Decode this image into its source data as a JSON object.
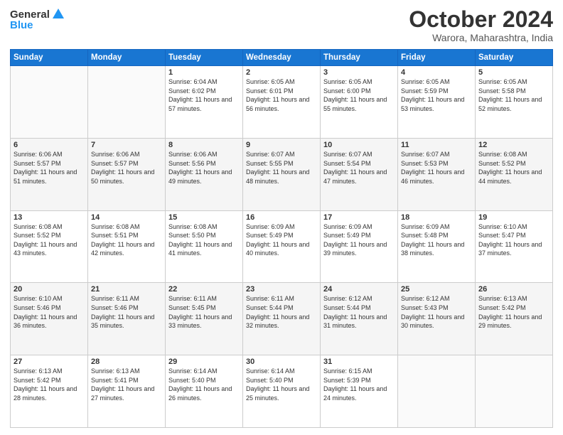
{
  "header": {
    "logo_line1": "General",
    "logo_line2": "Blue",
    "month": "October 2024",
    "location": "Warora, Maharashtra, India"
  },
  "weekdays": [
    "Sunday",
    "Monday",
    "Tuesday",
    "Wednesday",
    "Thursday",
    "Friday",
    "Saturday"
  ],
  "weeks": [
    [
      {
        "day": "",
        "info": ""
      },
      {
        "day": "",
        "info": ""
      },
      {
        "day": "1",
        "info": "Sunrise: 6:04 AM\nSunset: 6:02 PM\nDaylight: 11 hours and 57 minutes."
      },
      {
        "day": "2",
        "info": "Sunrise: 6:05 AM\nSunset: 6:01 PM\nDaylight: 11 hours and 56 minutes."
      },
      {
        "day": "3",
        "info": "Sunrise: 6:05 AM\nSunset: 6:00 PM\nDaylight: 11 hours and 55 minutes."
      },
      {
        "day": "4",
        "info": "Sunrise: 6:05 AM\nSunset: 5:59 PM\nDaylight: 11 hours and 53 minutes."
      },
      {
        "day": "5",
        "info": "Sunrise: 6:05 AM\nSunset: 5:58 PM\nDaylight: 11 hours and 52 minutes."
      }
    ],
    [
      {
        "day": "6",
        "info": "Sunrise: 6:06 AM\nSunset: 5:57 PM\nDaylight: 11 hours and 51 minutes."
      },
      {
        "day": "7",
        "info": "Sunrise: 6:06 AM\nSunset: 5:57 PM\nDaylight: 11 hours and 50 minutes."
      },
      {
        "day": "8",
        "info": "Sunrise: 6:06 AM\nSunset: 5:56 PM\nDaylight: 11 hours and 49 minutes."
      },
      {
        "day": "9",
        "info": "Sunrise: 6:07 AM\nSunset: 5:55 PM\nDaylight: 11 hours and 48 minutes."
      },
      {
        "day": "10",
        "info": "Sunrise: 6:07 AM\nSunset: 5:54 PM\nDaylight: 11 hours and 47 minutes."
      },
      {
        "day": "11",
        "info": "Sunrise: 6:07 AM\nSunset: 5:53 PM\nDaylight: 11 hours and 46 minutes."
      },
      {
        "day": "12",
        "info": "Sunrise: 6:08 AM\nSunset: 5:52 PM\nDaylight: 11 hours and 44 minutes."
      }
    ],
    [
      {
        "day": "13",
        "info": "Sunrise: 6:08 AM\nSunset: 5:52 PM\nDaylight: 11 hours and 43 minutes."
      },
      {
        "day": "14",
        "info": "Sunrise: 6:08 AM\nSunset: 5:51 PM\nDaylight: 11 hours and 42 minutes."
      },
      {
        "day": "15",
        "info": "Sunrise: 6:08 AM\nSunset: 5:50 PM\nDaylight: 11 hours and 41 minutes."
      },
      {
        "day": "16",
        "info": "Sunrise: 6:09 AM\nSunset: 5:49 PM\nDaylight: 11 hours and 40 minutes."
      },
      {
        "day": "17",
        "info": "Sunrise: 6:09 AM\nSunset: 5:49 PM\nDaylight: 11 hours and 39 minutes."
      },
      {
        "day": "18",
        "info": "Sunrise: 6:09 AM\nSunset: 5:48 PM\nDaylight: 11 hours and 38 minutes."
      },
      {
        "day": "19",
        "info": "Sunrise: 6:10 AM\nSunset: 5:47 PM\nDaylight: 11 hours and 37 minutes."
      }
    ],
    [
      {
        "day": "20",
        "info": "Sunrise: 6:10 AM\nSunset: 5:46 PM\nDaylight: 11 hours and 36 minutes."
      },
      {
        "day": "21",
        "info": "Sunrise: 6:11 AM\nSunset: 5:46 PM\nDaylight: 11 hours and 35 minutes."
      },
      {
        "day": "22",
        "info": "Sunrise: 6:11 AM\nSunset: 5:45 PM\nDaylight: 11 hours and 33 minutes."
      },
      {
        "day": "23",
        "info": "Sunrise: 6:11 AM\nSunset: 5:44 PM\nDaylight: 11 hours and 32 minutes."
      },
      {
        "day": "24",
        "info": "Sunrise: 6:12 AM\nSunset: 5:44 PM\nDaylight: 11 hours and 31 minutes."
      },
      {
        "day": "25",
        "info": "Sunrise: 6:12 AM\nSunset: 5:43 PM\nDaylight: 11 hours and 30 minutes."
      },
      {
        "day": "26",
        "info": "Sunrise: 6:13 AM\nSunset: 5:42 PM\nDaylight: 11 hours and 29 minutes."
      }
    ],
    [
      {
        "day": "27",
        "info": "Sunrise: 6:13 AM\nSunset: 5:42 PM\nDaylight: 11 hours and 28 minutes."
      },
      {
        "day": "28",
        "info": "Sunrise: 6:13 AM\nSunset: 5:41 PM\nDaylight: 11 hours and 27 minutes."
      },
      {
        "day": "29",
        "info": "Sunrise: 6:14 AM\nSunset: 5:40 PM\nDaylight: 11 hours and 26 minutes."
      },
      {
        "day": "30",
        "info": "Sunrise: 6:14 AM\nSunset: 5:40 PM\nDaylight: 11 hours and 25 minutes."
      },
      {
        "day": "31",
        "info": "Sunrise: 6:15 AM\nSunset: 5:39 PM\nDaylight: 11 hours and 24 minutes."
      },
      {
        "day": "",
        "info": ""
      },
      {
        "day": "",
        "info": ""
      }
    ]
  ]
}
